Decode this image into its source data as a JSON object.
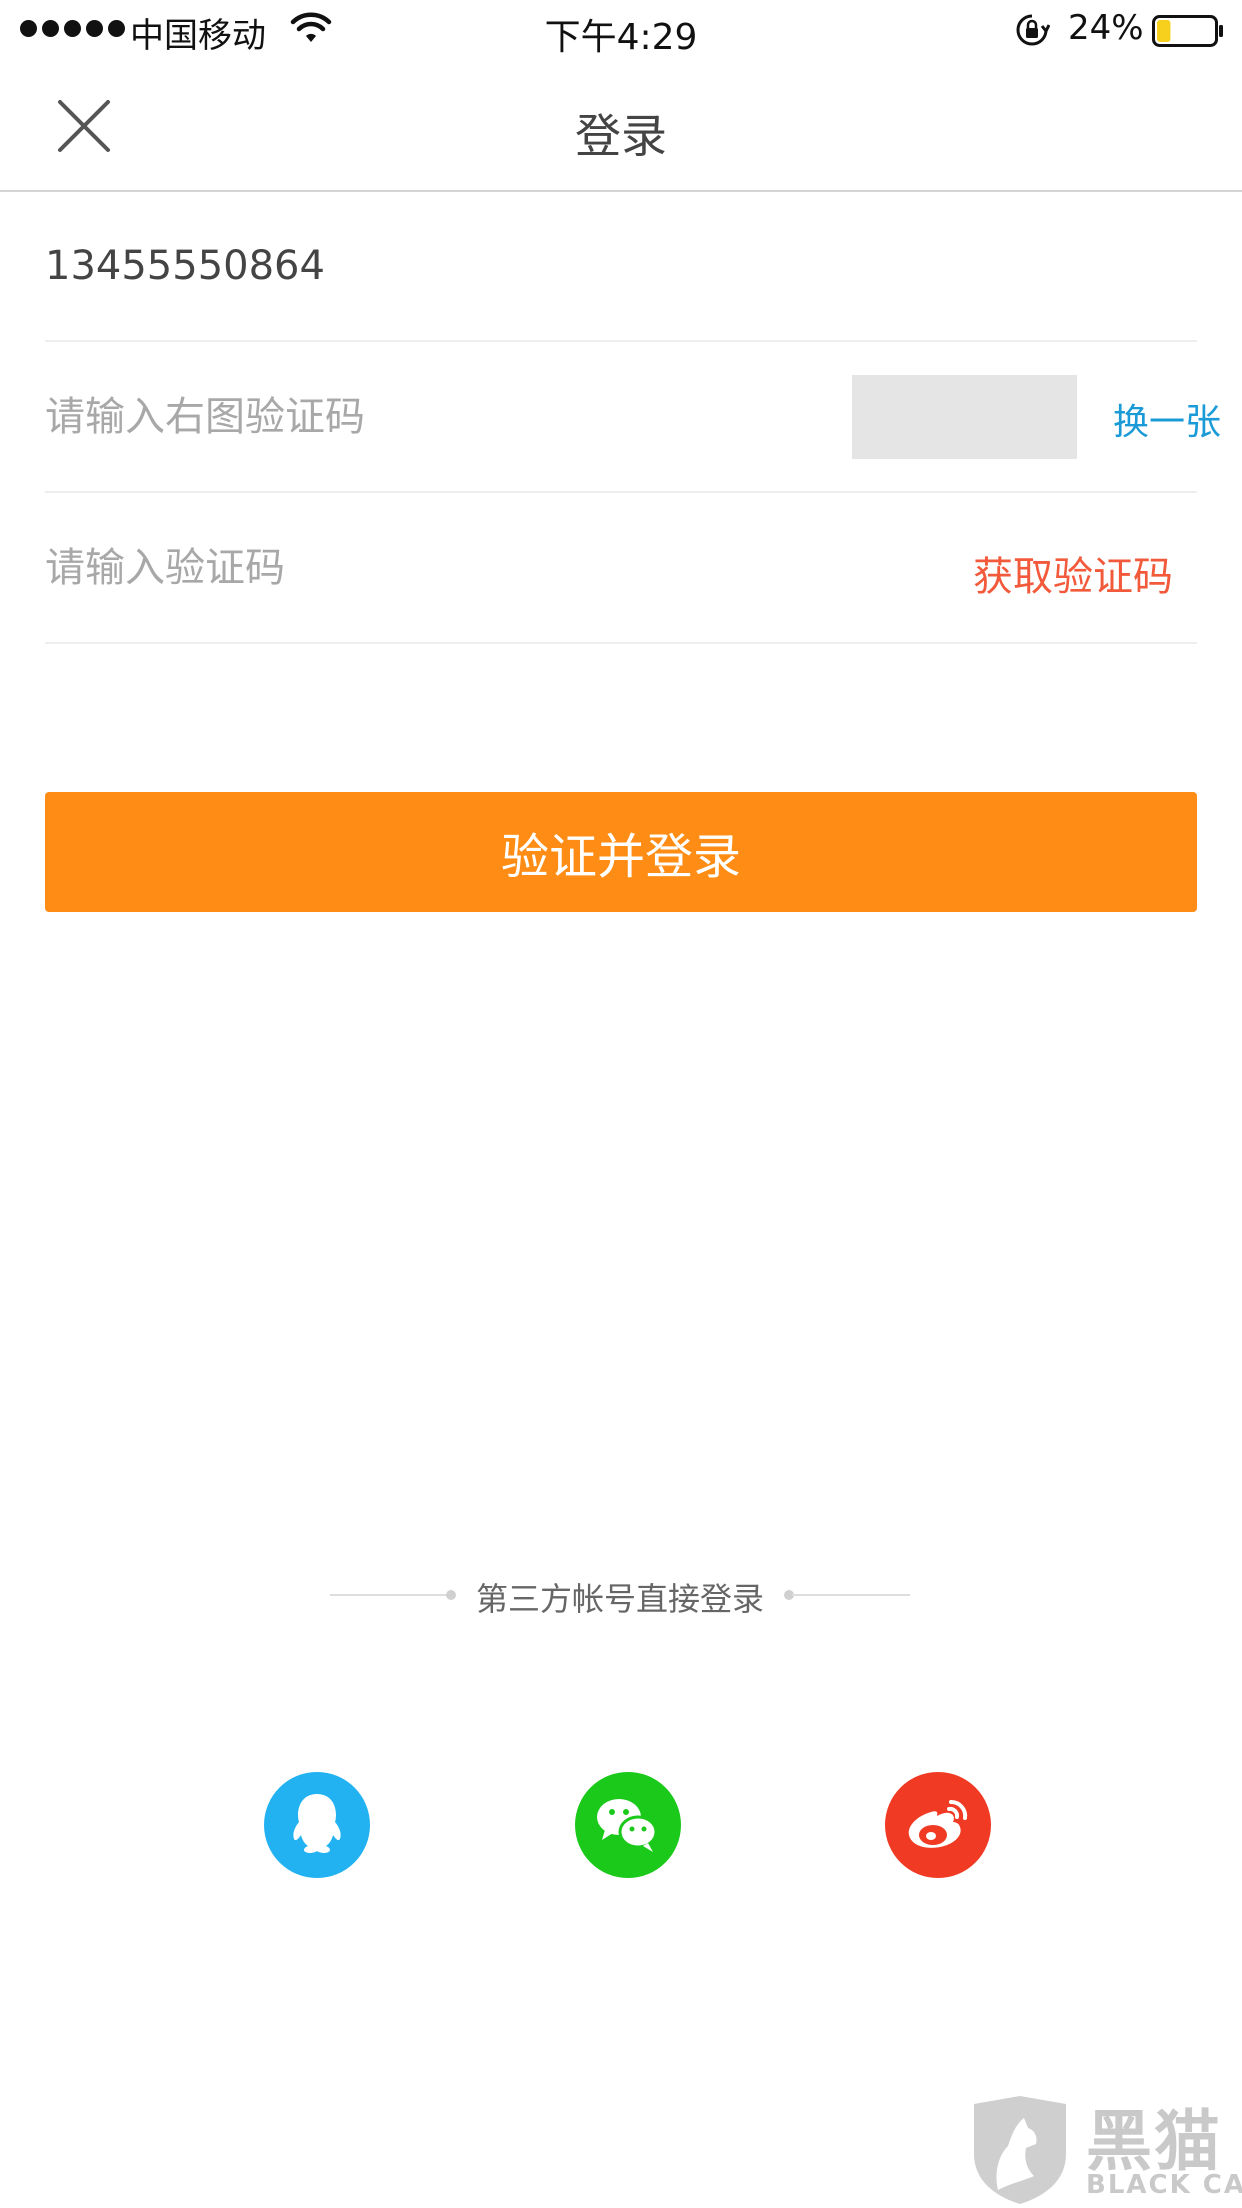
{
  "status_bar": {
    "carrier": "中国移动",
    "time": "下午4:29",
    "battery_percent": "24%",
    "battery_level": 0.24,
    "signal_icon": "signal-dots-icon",
    "wifi_icon": "wifi-icon",
    "lock_icon": "rotation-lock-icon",
    "battery_icon": "battery-icon"
  },
  "nav": {
    "title": "登录",
    "close_icon": "close-icon"
  },
  "form": {
    "phone_value": "13455550864",
    "captcha_placeholder": "请输入右图验证码",
    "refresh_captcha_label": "换一张",
    "sms_code_placeholder": "请输入验证码",
    "get_code_label": "获取验证码",
    "submit_label": "验证并登录"
  },
  "third_party": {
    "divider_text": "第三方帐号直接登录",
    "providers": [
      {
        "icon": "qq-icon",
        "color": "#22b2f2"
      },
      {
        "icon": "wechat-icon",
        "color": "#1bc91b"
      },
      {
        "icon": "weibo-icon",
        "color": "#f03a24"
      }
    ]
  },
  "watermark": {
    "text_cn": "黑猫",
    "text_en": "BLACK CAT"
  },
  "colors": {
    "accent": "#ff8c14",
    "link_blue": "#1a9bd7",
    "link_red": "#f25a3b"
  }
}
